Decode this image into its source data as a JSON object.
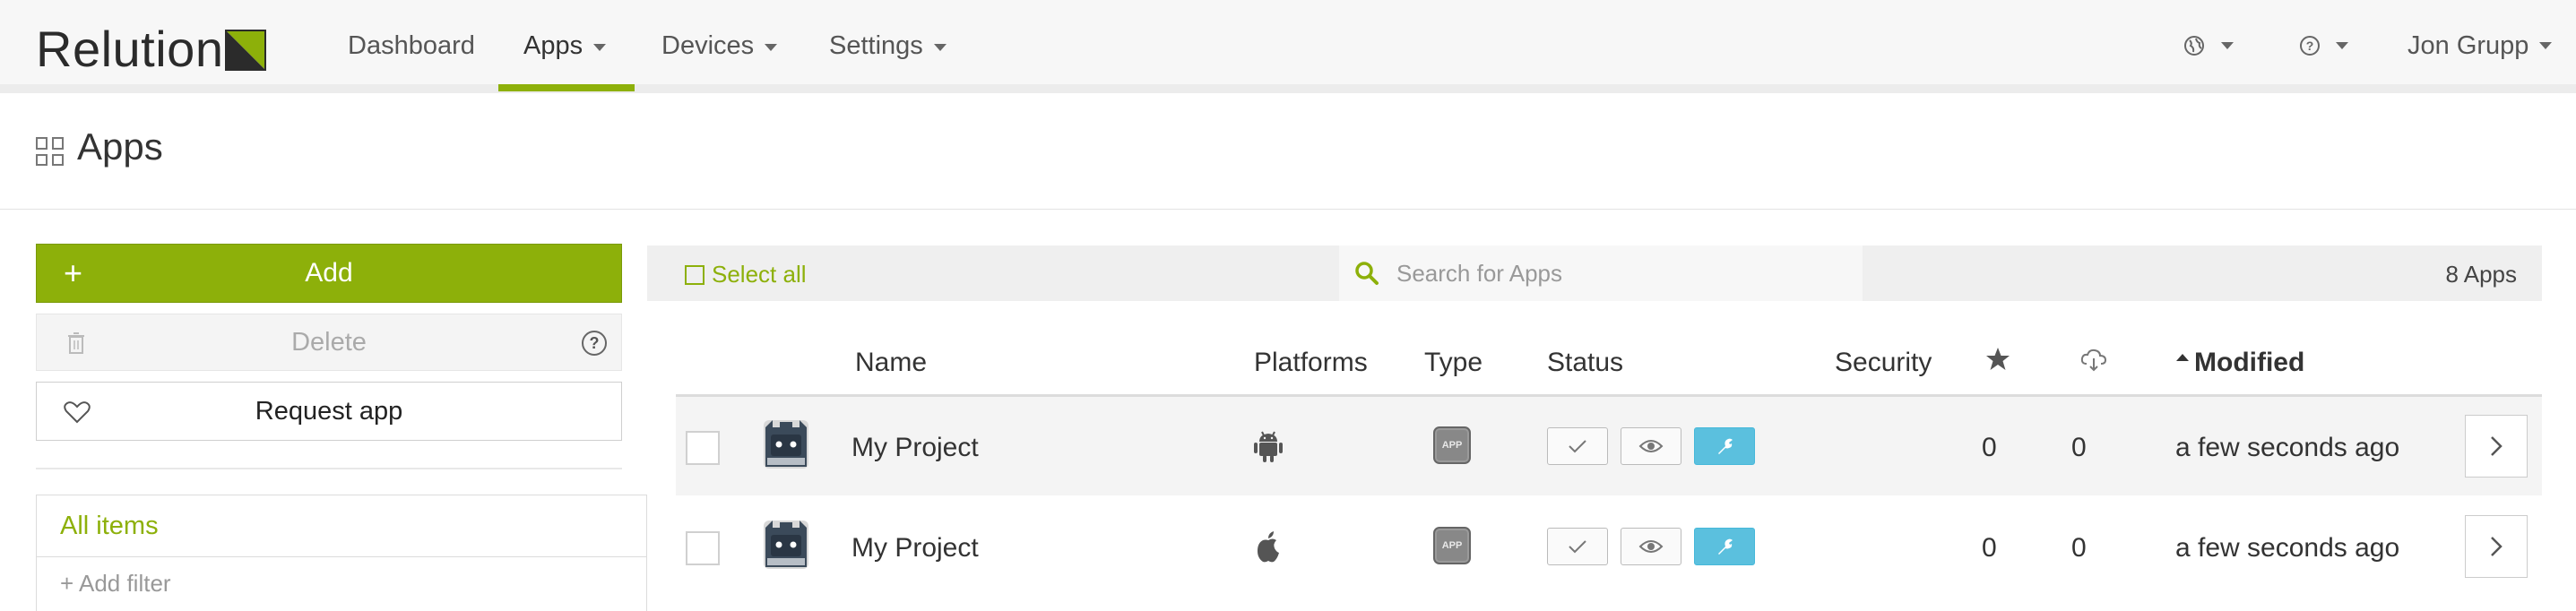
{
  "brand": {
    "name": "Relution",
    "accent": "#8db00a"
  },
  "nav": {
    "items": [
      {
        "label": "Dashboard",
        "has_caret": false,
        "active": false
      },
      {
        "label": "Apps",
        "has_caret": true,
        "active": true
      },
      {
        "label": "Devices",
        "has_caret": true,
        "active": false
      },
      {
        "label": "Settings",
        "has_caret": true,
        "active": false
      }
    ],
    "right": {
      "globe_icon": "globe-icon",
      "help_icon": "question-icon",
      "user": "Jon Grupp"
    }
  },
  "page": {
    "title": "Apps",
    "icon": "apps-grid-icon"
  },
  "sidebar": {
    "add_label": "Add",
    "delete_label": "Delete",
    "request_label": "Request app",
    "all_items_label": "All items",
    "add_filter_label": "+ Add filter"
  },
  "toolbar": {
    "select_all": "Select all",
    "search_placeholder": "Search for Apps",
    "count": "8 Apps"
  },
  "table": {
    "columns": {
      "name": "Name",
      "platforms": "Platforms",
      "type": "Type",
      "status": "Status",
      "security": "Security",
      "modified": "Modified"
    },
    "sort": {
      "column": "modified",
      "direction": "asc"
    },
    "rows": [
      {
        "name": "My Project",
        "platform": "android",
        "type": "APP",
        "rating": "0",
        "downloads": "0",
        "modified": "a few seconds ago"
      },
      {
        "name": "My Project",
        "platform": "ios",
        "type": "APP",
        "rating": "0",
        "downloads": "0",
        "modified": "a few seconds ago"
      }
    ]
  },
  "colors": {
    "accent": "#8db00a",
    "info": "#5bc0de"
  }
}
